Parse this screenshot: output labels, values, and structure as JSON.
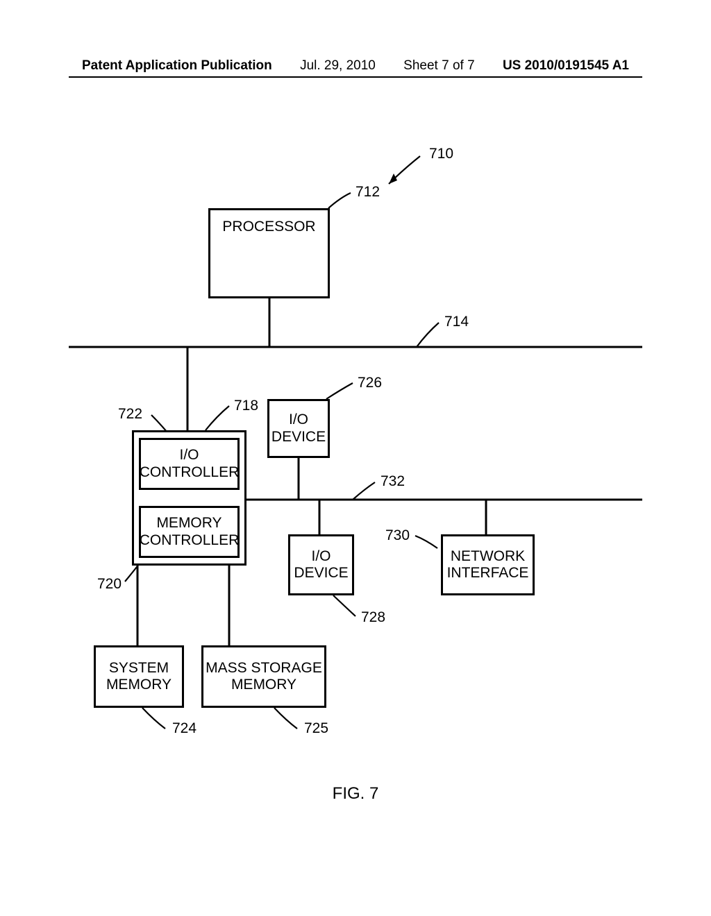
{
  "header": {
    "pub": "Patent Application Publication",
    "date": "Jul. 29, 2010",
    "sheet": "Sheet 7 of 7",
    "pubno": "US 2010/0191545 A1"
  },
  "labels": {
    "l710": "710",
    "l712": "712",
    "l714": "714",
    "l718": "718",
    "l720": "720",
    "l722": "722",
    "l724": "724",
    "l725": "725",
    "l726": "726",
    "l728": "728",
    "l730": "730",
    "l732": "732"
  },
  "boxes": {
    "processor": "PROCESSOR",
    "io_ctrl_l1": "I/O",
    "io_ctrl_l2": "CONTROLLER",
    "mem_ctrl_l1": "MEMORY",
    "mem_ctrl_l2": "CONTROLLER",
    "io_dev_l1": "I/O",
    "io_dev_l2": "DEVICE",
    "net_l1": "NETWORK",
    "net_l2": "INTERFACE",
    "sysmem_l1": "SYSTEM",
    "sysmem_l2": "MEMORY",
    "mass_l1": "MASS STORAGE",
    "mass_l2": "MEMORY"
  },
  "caption": "FIG. 7"
}
